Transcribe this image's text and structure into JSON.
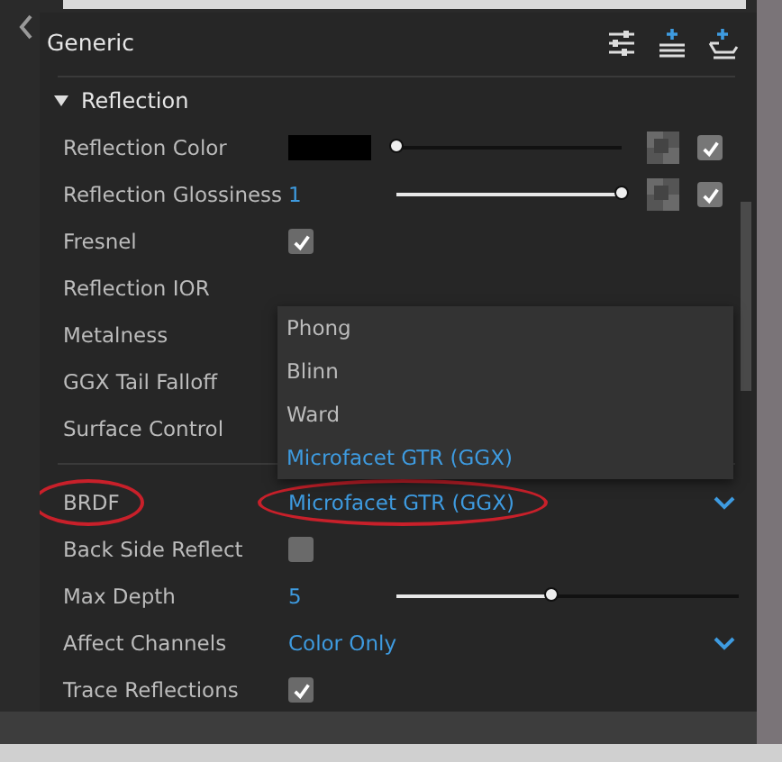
{
  "window": {
    "title": "Generic"
  },
  "rows": [
    {
      "kind": "divider"
    },
    {
      "kind": "section",
      "label": "Reflection",
      "expanded": true
    },
    {
      "kind": "color",
      "label": "Reflection Color",
      "color": "#000000",
      "level": 0,
      "checked": true,
      "circled": false
    },
    {
      "kind": "number",
      "label": "Reflection Glossiness",
      "value": "1",
      "level": 1,
      "checked": true,
      "circled": false
    },
    {
      "kind": "checkbox",
      "label": "Fresnel",
      "checked": true,
      "circled": false
    },
    {
      "kind": "label",
      "label": "Reflection IOR",
      "circled": false
    },
    {
      "kind": "label",
      "label": "Metalness",
      "circled": false
    },
    {
      "kind": "label",
      "label": "GGX Tail Falloff",
      "circled": false
    },
    {
      "kind": "label",
      "label": "Surface Control",
      "circled": false
    },
    {
      "kind": "divider"
    },
    {
      "kind": "dropdown",
      "label": "BRDF",
      "value": "Microfacet GTR (GGX)",
      "circled": true
    },
    {
      "kind": "checkbox",
      "label": "Back Side Reflect",
      "checked": false,
      "circled": false
    },
    {
      "kind": "slider",
      "label": "Max Depth",
      "value": "5",
      "level": 0.45,
      "circled": false
    },
    {
      "kind": "dropdown",
      "label": "Affect Channels",
      "value": "Color Only",
      "circled": false
    },
    {
      "kind": "checkbox",
      "label": "Trace Reflections",
      "checked": true,
      "circled": false
    }
  ],
  "popup": {
    "options": [
      {
        "label": "Phong",
        "selected": false
      },
      {
        "label": "Blinn",
        "selected": false
      },
      {
        "label": "Ward",
        "selected": false
      },
      {
        "label": "Microfacet GTR (GGX)",
        "selected": true
      }
    ]
  }
}
